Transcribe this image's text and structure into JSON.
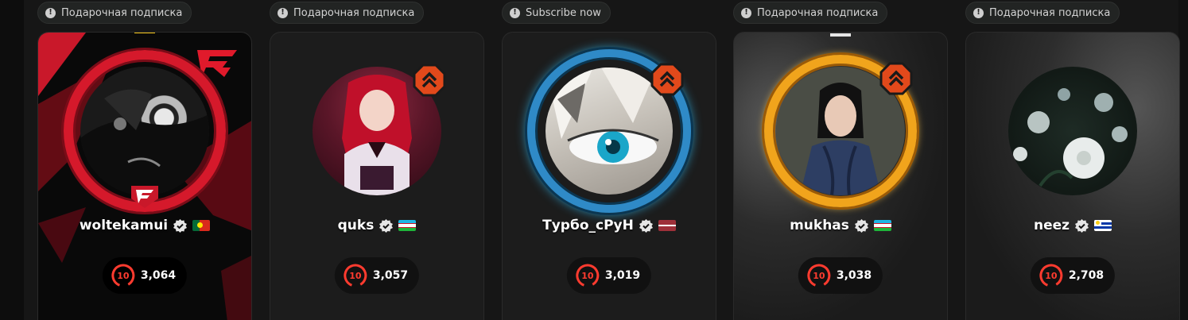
{
  "cards": [
    {
      "tag_label": "Подарочная подписка",
      "tag_icon": "info-icon",
      "username": "woltekamui",
      "flag": "portugal-flag",
      "level": "10",
      "elo": "3,064",
      "frame": "faze-red-frame",
      "crown": "gold-crown-icon",
      "colors": {
        "accent": "#d5192b"
      }
    },
    {
      "tag_label": "Подарочная подписка",
      "tag_icon": "info-icon",
      "username": "quks",
      "flag": "uzbekistan-flag",
      "level": "10",
      "elo": "3,057",
      "rank_icon": "orange-chevron-rank-icon"
    },
    {
      "tag_label": "Subscribe now",
      "tag_icon": "info-icon",
      "username": "Турбо_сРуН",
      "flag": "latvia-flag",
      "level": "10",
      "elo": "3,019",
      "rank_icon": "orange-chevron-rank-icon",
      "colors": {
        "ring": "#2f8ac7"
      }
    },
    {
      "tag_label": "Подарочная подписка",
      "tag_icon": "info-icon",
      "username": "mukhas",
      "flag": "uzbekistan-flag",
      "level": "10",
      "elo": "3,038",
      "rank_icon": "orange-chevron-rank-icon",
      "crown": "silver-crown-icon",
      "colors": {
        "ring": "#f1a41c"
      }
    },
    {
      "tag_label": "Подарочная подписка",
      "tag_icon": "info-icon",
      "username": "neez",
      "flag": "uruguay-flag",
      "level": "10",
      "elo": "2,708"
    }
  ],
  "tag_icon_glyph": "!",
  "level_color": "#ff3b2f"
}
